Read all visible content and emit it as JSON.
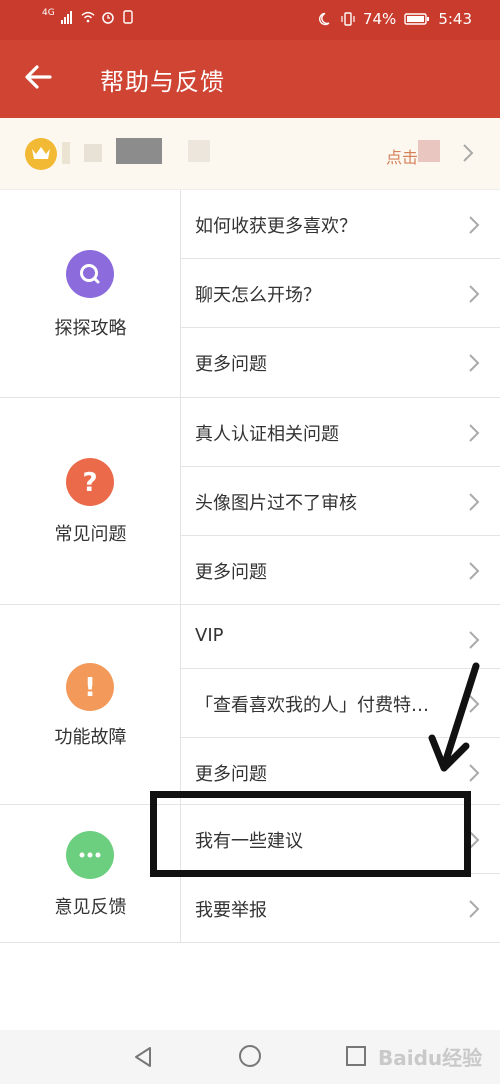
{
  "status_bar": {
    "network": "4G",
    "battery_percent": "74%",
    "time": "5:43"
  },
  "header": {
    "title": "帮助与反馈",
    "back_icon": "arrow-left-icon"
  },
  "vip_banner": {
    "hint_text": "点击"
  },
  "sections": [
    {
      "category": "探探攻略",
      "icon": "search-icon",
      "color": "#8c6bdc",
      "items": [
        "如何收获更多喜欢？",
        "聊天怎么开场？",
        "更多问题"
      ]
    },
    {
      "category": "常见问题",
      "icon": "question-icon",
      "color": "#ea6a4a",
      "items": [
        "真人认证相关问题",
        "头像图片过不了审核",
        "更多问题"
      ]
    },
    {
      "category": "功能故障",
      "icon": "exclamation-icon",
      "color": "#f39a5a",
      "items": [
        "VIP",
        "「查看喜欢我的人」付费特…",
        "更多问题"
      ]
    },
    {
      "category": "意见反馈",
      "icon": "more-dots-icon",
      "color": "#6ccf7f",
      "items": [
        "我有一些建议",
        "我要举报"
      ]
    }
  ],
  "nav_bar": {
    "back_icon": "triangle-back-icon",
    "home_icon": "circle-home-icon",
    "recents_icon": "square-recents-icon"
  },
  "watermark": "Baidu经验"
}
